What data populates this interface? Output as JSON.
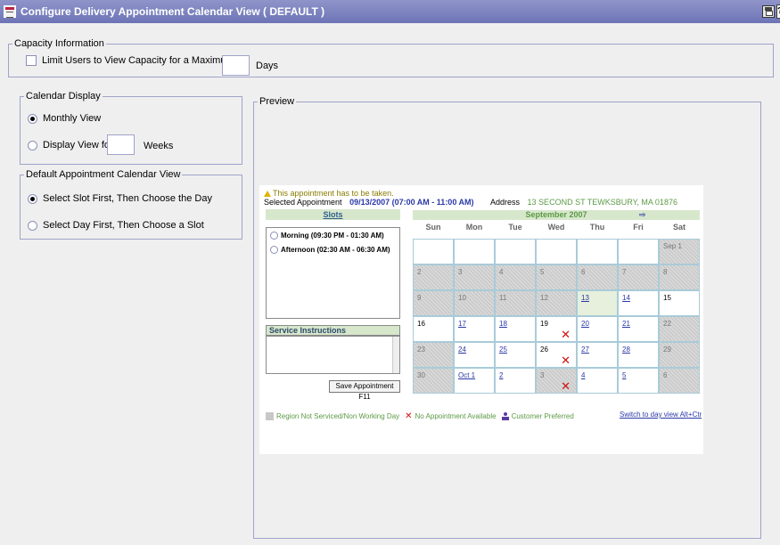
{
  "window": {
    "title": "Configure Delivery Appointment Calendar View ( DEFAULT )",
    "help_label": "?"
  },
  "capacity": {
    "legend": "Capacity Information",
    "limit_label": "Limit Users to View Capacity for a Maximum of",
    "limit_checked": false,
    "days_value": "",
    "days_label": "Days"
  },
  "calendar_display": {
    "legend": "Calendar Display",
    "monthly_label": "Monthly View",
    "display_for_label": "Display View for",
    "weeks_value": "",
    "weeks_label": "Weeks",
    "selected": "monthly"
  },
  "default_view": {
    "legend": "Default Appointment Calendar View",
    "slot_first_label": "Select Slot First, Then Choose the Day",
    "day_first_label": "Select Day First, Then Choose a Slot",
    "selected": "slot_first"
  },
  "preview": {
    "legend": "Preview",
    "warning": "This appointment has to be taken.",
    "selected_appt_label": "Selected Appointment",
    "selected_appt_value": "09/13/2007 (07:00 AM - 11:00 AM)",
    "address_label": "Address",
    "address_value": "13 SECOND ST TEWKSBURY, MA 01876",
    "slots_heading": "Slots",
    "slots": [
      "Morning (09:30 PM - 01:30 AM)",
      "Afternoon (02:30 AM - 06:30 AM)"
    ],
    "service_heading": "Service Instructions",
    "save_button": "Save Appointment  F11",
    "month_title": "September 2007",
    "next_arrow": "⇨",
    "weekdays": [
      "Sun",
      "Mon",
      "Tue",
      "Wed",
      "Thu",
      "Fri",
      "Sat"
    ],
    "weeks": [
      [
        "",
        "",
        "",
        "",
        "",
        "",
        "Sep 1"
      ],
      [
        "2",
        "3",
        "4",
        "5",
        "6",
        "7",
        "8"
      ],
      [
        "9",
        "10",
        "11",
        "12",
        "13",
        "14",
        "15"
      ],
      [
        "16",
        "17",
        "18",
        "19",
        "20",
        "21",
        "22"
      ],
      [
        "23",
        "24",
        "25",
        "26",
        "27",
        "28",
        "29"
      ],
      [
        "30",
        "Oct 1",
        "2",
        "3",
        "4",
        "5",
        "6"
      ]
    ],
    "legend_not_serviced": "Region Not Serviced/Non Working Day",
    "legend_no_appt": "No Appointment Available",
    "legend_preferred": "Customer Preferred",
    "switch_link": "Switch to day view  Alt+Ctrl+S"
  }
}
